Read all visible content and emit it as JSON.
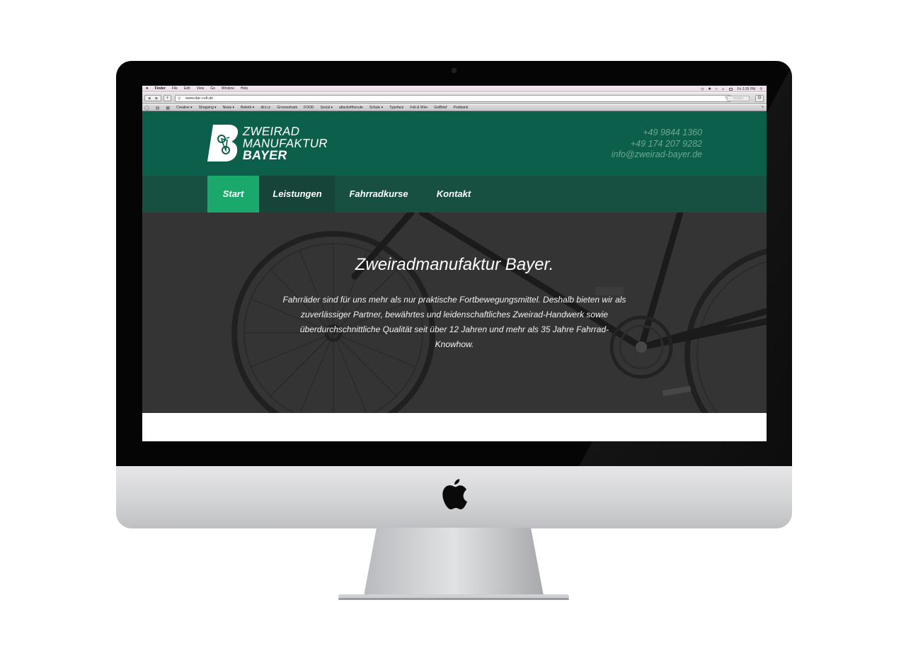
{
  "os_menubar": {
    "apple_icon": "apple-icon",
    "items": [
      "Finder",
      "File",
      "Edit",
      "View",
      "Go",
      "Window",
      "Help"
    ],
    "clock": "Fri 3:35 PM"
  },
  "browser": {
    "url": "www.dar-cult.de",
    "reader_label": "Reader",
    "bookmarks": [
      "Creative ▾",
      "Shopping ▾",
      "News ▾",
      "Beliebt ▾",
      "dict.cc",
      "Grooveshark",
      "FOOD",
      "Social ▾",
      "attackofthecute",
      "Schule ▾",
      "Typeface",
      "Felt & Wire",
      "GotBrief",
      "Postbank"
    ]
  },
  "site": {
    "brand": {
      "line1": "ZWEIRAD",
      "line2": "MANUFAKTUR",
      "line3": "BAYER",
      "badge_letter": "B"
    },
    "contact": {
      "phone1": "+49 9844 1360",
      "phone2": "+49 174 207 9282",
      "email": "info@zweirad-bayer.de"
    },
    "nav": [
      "Start",
      "Leistungen",
      "Fahrradkurse",
      "Kontakt"
    ],
    "active_nav": "Start",
    "hero": {
      "title": "Zweiradmanufaktur Bayer.",
      "text": "Fahrräder sind für uns mehr als nur praktische Fortbewegungsmittel. Deshalb bieten wir als zuverlässiger Partner, bewährtes und leidenschaftliches Zweirad-Handwerk sowie überdurchschnittliche Qualität seit über 12 Jahren und mehr als 35 Jahre Fahrrad-Knowhow."
    }
  },
  "colors": {
    "header_green": "#0c5f4a",
    "nav_green": "#174f40",
    "active_green": "#1aa86d",
    "contact_text": "#6ea793",
    "hero_bg": "#363636"
  }
}
